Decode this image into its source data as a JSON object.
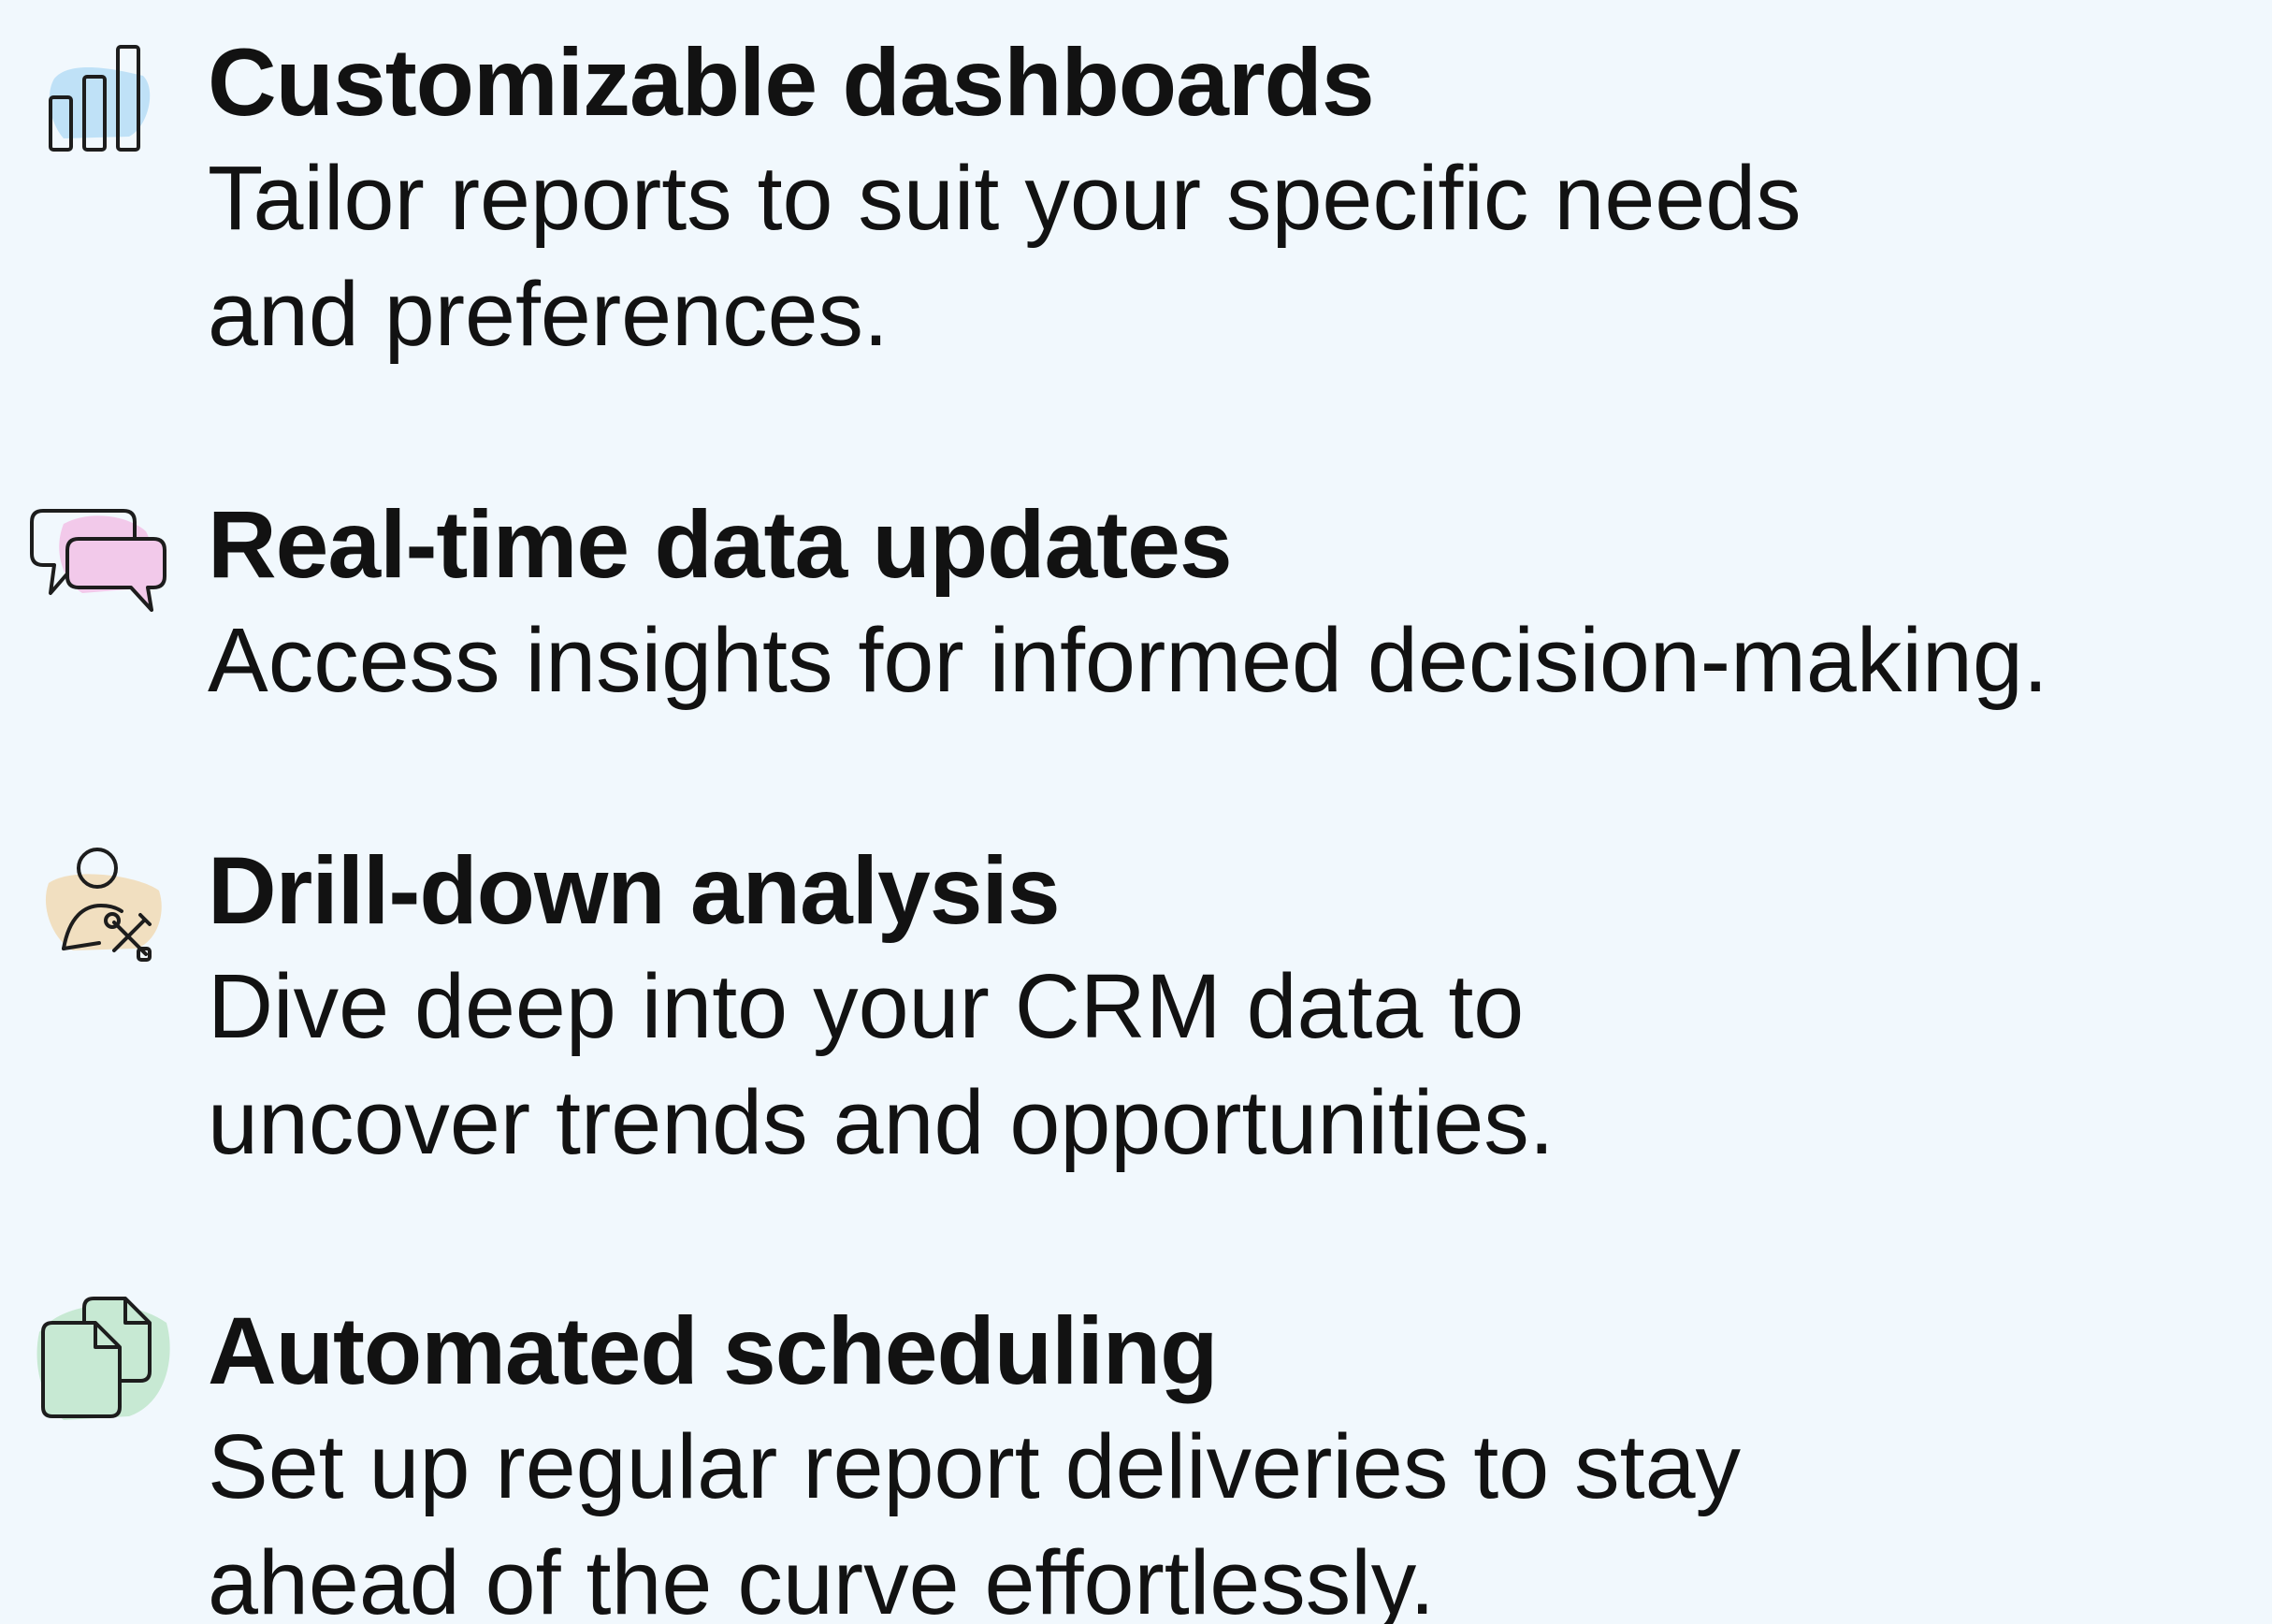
{
  "features": [
    {
      "icon": "bar-chart-icon",
      "accent": "#bfe1f7",
      "title": "Customizable dashboards",
      "desc_line1": "Tailor reports to suit your specific needs",
      "desc_line2": "and preferences."
    },
    {
      "icon": "chat-bubbles-icon",
      "accent": "#f2c9ea",
      "title": "Real-time data updates",
      "desc_line1": "Access insights for informed decision-making.",
      "desc_line2": ""
    },
    {
      "icon": "person-tools-icon",
      "accent": "#f1dfc0",
      "title": "Drill-down analysis",
      "desc_line1": "Dive deep into your CRM data to",
      "desc_line2": "uncover trends and opportunities."
    },
    {
      "icon": "documents-icon",
      "accent": "#c7e9d3",
      "title": "Automated scheduling",
      "desc_line1": "Set up regular report deliveries to stay",
      "desc_line2": "ahead of the curve effortlessly."
    }
  ]
}
